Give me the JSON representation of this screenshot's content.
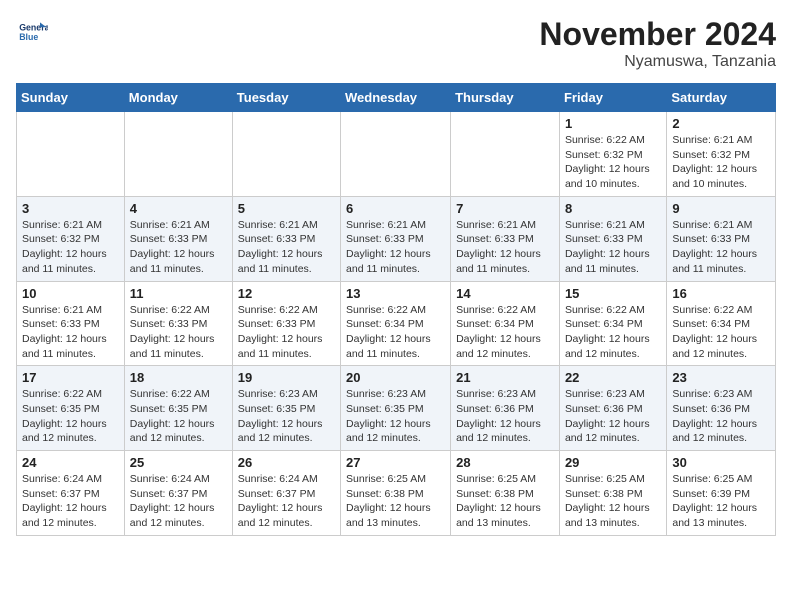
{
  "logo": {
    "line1": "General",
    "line2": "Blue"
  },
  "title": "November 2024",
  "location": "Nyamuswa, Tanzania",
  "weekdays": [
    "Sunday",
    "Monday",
    "Tuesday",
    "Wednesday",
    "Thursday",
    "Friday",
    "Saturday"
  ],
  "weeks": [
    [
      {
        "day": "",
        "info": ""
      },
      {
        "day": "",
        "info": ""
      },
      {
        "day": "",
        "info": ""
      },
      {
        "day": "",
        "info": ""
      },
      {
        "day": "",
        "info": ""
      },
      {
        "day": "1",
        "info": "Sunrise: 6:22 AM\nSunset: 6:32 PM\nDaylight: 12 hours\nand 10 minutes."
      },
      {
        "day": "2",
        "info": "Sunrise: 6:21 AM\nSunset: 6:32 PM\nDaylight: 12 hours\nand 10 minutes."
      }
    ],
    [
      {
        "day": "3",
        "info": "Sunrise: 6:21 AM\nSunset: 6:32 PM\nDaylight: 12 hours\nand 11 minutes."
      },
      {
        "day": "4",
        "info": "Sunrise: 6:21 AM\nSunset: 6:33 PM\nDaylight: 12 hours\nand 11 minutes."
      },
      {
        "day": "5",
        "info": "Sunrise: 6:21 AM\nSunset: 6:33 PM\nDaylight: 12 hours\nand 11 minutes."
      },
      {
        "day": "6",
        "info": "Sunrise: 6:21 AM\nSunset: 6:33 PM\nDaylight: 12 hours\nand 11 minutes."
      },
      {
        "day": "7",
        "info": "Sunrise: 6:21 AM\nSunset: 6:33 PM\nDaylight: 12 hours\nand 11 minutes."
      },
      {
        "day": "8",
        "info": "Sunrise: 6:21 AM\nSunset: 6:33 PM\nDaylight: 12 hours\nand 11 minutes."
      },
      {
        "day": "9",
        "info": "Sunrise: 6:21 AM\nSunset: 6:33 PM\nDaylight: 12 hours\nand 11 minutes."
      }
    ],
    [
      {
        "day": "10",
        "info": "Sunrise: 6:21 AM\nSunset: 6:33 PM\nDaylight: 12 hours\nand 11 minutes."
      },
      {
        "day": "11",
        "info": "Sunrise: 6:22 AM\nSunset: 6:33 PM\nDaylight: 12 hours\nand 11 minutes."
      },
      {
        "day": "12",
        "info": "Sunrise: 6:22 AM\nSunset: 6:33 PM\nDaylight: 12 hours\nand 11 minutes."
      },
      {
        "day": "13",
        "info": "Sunrise: 6:22 AM\nSunset: 6:34 PM\nDaylight: 12 hours\nand 11 minutes."
      },
      {
        "day": "14",
        "info": "Sunrise: 6:22 AM\nSunset: 6:34 PM\nDaylight: 12 hours\nand 12 minutes."
      },
      {
        "day": "15",
        "info": "Sunrise: 6:22 AM\nSunset: 6:34 PM\nDaylight: 12 hours\nand 12 minutes."
      },
      {
        "day": "16",
        "info": "Sunrise: 6:22 AM\nSunset: 6:34 PM\nDaylight: 12 hours\nand 12 minutes."
      }
    ],
    [
      {
        "day": "17",
        "info": "Sunrise: 6:22 AM\nSunset: 6:35 PM\nDaylight: 12 hours\nand 12 minutes."
      },
      {
        "day": "18",
        "info": "Sunrise: 6:22 AM\nSunset: 6:35 PM\nDaylight: 12 hours\nand 12 minutes."
      },
      {
        "day": "19",
        "info": "Sunrise: 6:23 AM\nSunset: 6:35 PM\nDaylight: 12 hours\nand 12 minutes."
      },
      {
        "day": "20",
        "info": "Sunrise: 6:23 AM\nSunset: 6:35 PM\nDaylight: 12 hours\nand 12 minutes."
      },
      {
        "day": "21",
        "info": "Sunrise: 6:23 AM\nSunset: 6:36 PM\nDaylight: 12 hours\nand 12 minutes."
      },
      {
        "day": "22",
        "info": "Sunrise: 6:23 AM\nSunset: 6:36 PM\nDaylight: 12 hours\nand 12 minutes."
      },
      {
        "day": "23",
        "info": "Sunrise: 6:23 AM\nSunset: 6:36 PM\nDaylight: 12 hours\nand 12 minutes."
      }
    ],
    [
      {
        "day": "24",
        "info": "Sunrise: 6:24 AM\nSunset: 6:37 PM\nDaylight: 12 hours\nand 12 minutes."
      },
      {
        "day": "25",
        "info": "Sunrise: 6:24 AM\nSunset: 6:37 PM\nDaylight: 12 hours\nand 12 minutes."
      },
      {
        "day": "26",
        "info": "Sunrise: 6:24 AM\nSunset: 6:37 PM\nDaylight: 12 hours\nand 12 minutes."
      },
      {
        "day": "27",
        "info": "Sunrise: 6:25 AM\nSunset: 6:38 PM\nDaylight: 12 hours\nand 13 minutes."
      },
      {
        "day": "28",
        "info": "Sunrise: 6:25 AM\nSunset: 6:38 PM\nDaylight: 12 hours\nand 13 minutes."
      },
      {
        "day": "29",
        "info": "Sunrise: 6:25 AM\nSunset: 6:38 PM\nDaylight: 12 hours\nand 13 minutes."
      },
      {
        "day": "30",
        "info": "Sunrise: 6:25 AM\nSunset: 6:39 PM\nDaylight: 12 hours\nand 13 minutes."
      }
    ]
  ]
}
